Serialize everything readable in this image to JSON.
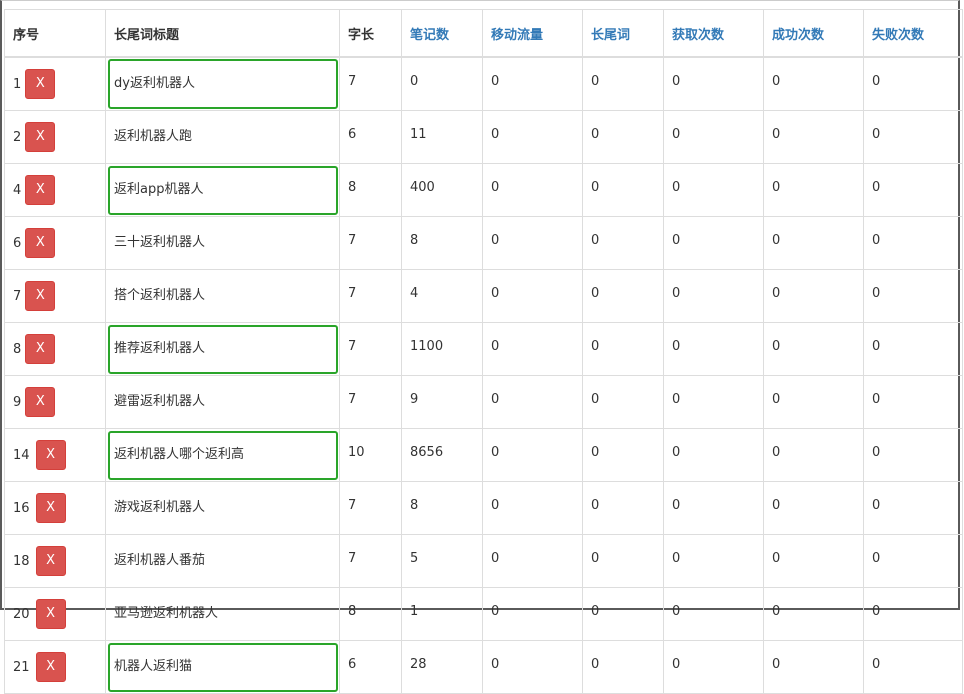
{
  "table": {
    "headers": [
      "序号",
      "长尾词标题",
      "字长",
      "笔记数",
      "移动流量",
      "长尾词",
      "获取次数",
      "成功次数",
      "失败次数"
    ],
    "delete_label": "X",
    "rows": [
      {
        "id": "1",
        "title": "dy返利机器人",
        "len": "7",
        "notes": "0",
        "mobile": "0",
        "longtail": "0",
        "fetch": "0",
        "success": "0",
        "fail": "0",
        "highlight": true
      },
      {
        "id": "2",
        "title": "返利机器人跑",
        "len": "6",
        "notes": "11",
        "mobile": "0",
        "longtail": "0",
        "fetch": "0",
        "success": "0",
        "fail": "0",
        "highlight": false
      },
      {
        "id": "4",
        "title": "返利app机器人",
        "len": "8",
        "notes": "400",
        "mobile": "0",
        "longtail": "0",
        "fetch": "0",
        "success": "0",
        "fail": "0",
        "highlight": true
      },
      {
        "id": "6",
        "title": "三十返利机器人",
        "len": "7",
        "notes": "8",
        "mobile": "0",
        "longtail": "0",
        "fetch": "0",
        "success": "0",
        "fail": "0",
        "highlight": false
      },
      {
        "id": "7",
        "title": "搭个返利机器人",
        "len": "7",
        "notes": "4",
        "mobile": "0",
        "longtail": "0",
        "fetch": "0",
        "success": "0",
        "fail": "0",
        "highlight": false
      },
      {
        "id": "8",
        "title": "推荐返利机器人",
        "len": "7",
        "notes": "1100",
        "mobile": "0",
        "longtail": "0",
        "fetch": "0",
        "success": "0",
        "fail": "0",
        "highlight": true
      },
      {
        "id": "9",
        "title": "避雷返利机器人",
        "len": "7",
        "notes": "9",
        "mobile": "0",
        "longtail": "0",
        "fetch": "0",
        "success": "0",
        "fail": "0",
        "highlight": false
      },
      {
        "id": "14",
        "title": "返利机器人哪个返利高",
        "len": "10",
        "notes": "8656",
        "mobile": "0",
        "longtail": "0",
        "fetch": "0",
        "success": "0",
        "fail": "0",
        "highlight": true
      },
      {
        "id": "16",
        "title": "游戏返利机器人",
        "len": "7",
        "notes": "8",
        "mobile": "0",
        "longtail": "0",
        "fetch": "0",
        "success": "0",
        "fail": "0",
        "highlight": false
      },
      {
        "id": "18",
        "title": "返利机器人番茄",
        "len": "7",
        "notes": "5",
        "mobile": "0",
        "longtail": "0",
        "fetch": "0",
        "success": "0",
        "fail": "0",
        "highlight": false
      },
      {
        "id": "20",
        "title": "亚马逊返利机器人",
        "len": "8",
        "notes": "1",
        "mobile": "0",
        "longtail": "0",
        "fetch": "0",
        "success": "0",
        "fail": "0",
        "highlight": false
      },
      {
        "id": "21",
        "title": "机器人返利猫",
        "len": "6",
        "notes": "28",
        "mobile": "0",
        "longtail": "0",
        "fetch": "0",
        "success": "0",
        "fail": "0",
        "highlight": true
      }
    ]
  },
  "colors": {
    "header_link": "#337ab7",
    "delete_button": "#d9534f",
    "highlight_border": "#2aa52a"
  }
}
